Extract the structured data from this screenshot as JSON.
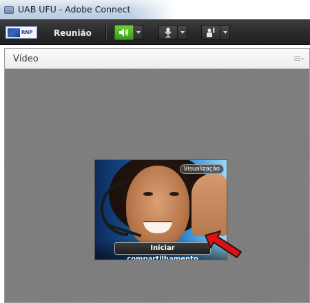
{
  "window": {
    "title": "UAB UFU - Adobe Connect"
  },
  "toolbar": {
    "logo_text": "RNP",
    "menu_label": "Reunião",
    "buttons": [
      {
        "icon": "speaker-icon",
        "active": true
      },
      {
        "icon": "microphone-icon",
        "active": false
      },
      {
        "icon": "raise-hand-icon",
        "active": false
      }
    ]
  },
  "pod": {
    "title": "Vídeo",
    "preview_badge": "Visualização",
    "share_button_label": "Iniciar compartilhamento"
  },
  "colors": {
    "toolbar_bg": "#2a2a2a",
    "active_green": "#4fb525",
    "annotation_arrow": "#e01010"
  }
}
